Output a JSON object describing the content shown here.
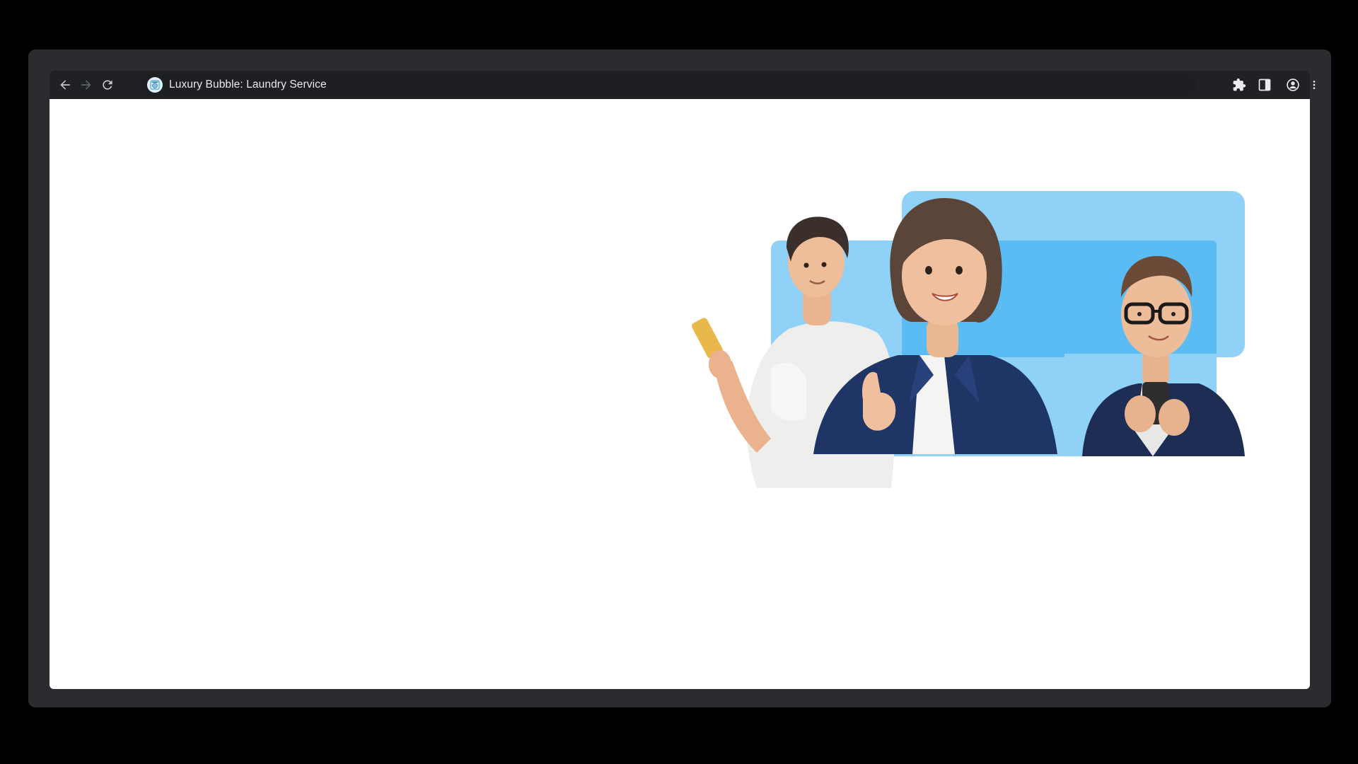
{
  "browser": {
    "tab_title": "Luxury Bubble: Laundry Service",
    "favicon": "laundry-bubble-favicon",
    "nav": {
      "back_icon": "arrow-left-icon",
      "forward_icon": "arrow-right-icon",
      "reload_icon": "reload-icon"
    },
    "toolbar_icons": [
      "puzzle-extensions-icon",
      "side-panel-icon",
      "account-circle-icon",
      "kebab-menu-icon"
    ]
  },
  "page": {
    "hero_image": "three-people-3d-illustration"
  },
  "colors": {
    "outer_background": "#000000",
    "window_frame": "#2b2c2f",
    "toolbar": "#202124",
    "text": "#e8eaed",
    "page_background": "#ffffff",
    "accent_blue_light": "#8fd1f7",
    "accent_blue": "#5bbcf4"
  }
}
